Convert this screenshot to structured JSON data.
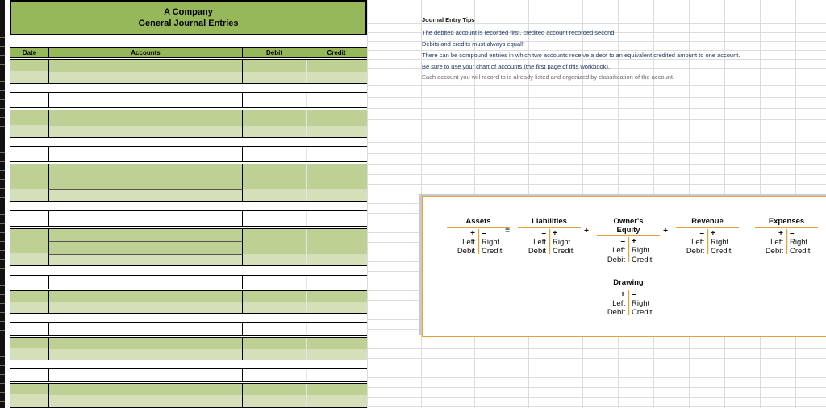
{
  "workbook": {
    "sheet_title_line1": "A Company",
    "sheet_title_line2": "General Journal Entries"
  },
  "journal": {
    "columns": {
      "date": "Date",
      "accounts": "Accounts",
      "debit": "Debit",
      "credit": "Credit"
    },
    "rows": []
  },
  "tips": {
    "heading": "Journal Entry Tips",
    "lines": [
      "The debited account is recorded first, credited account recorded second.",
      "Debits and credits must always equal!",
      "There can be compound entries in which two accounts receive a debt to an equivalent credited amount to one account.",
      "Be sure to use your chart of accounts (the first page of this workbook).",
      "Each account you will record to is already listed and organized by classification of the account."
    ]
  },
  "accounting_equation": {
    "accounts": [
      {
        "name": "Assets",
        "name_line1": "Assets",
        "name_line2": "",
        "left_sign": "+",
        "right_sign": "–",
        "left_side": "Left",
        "left_entry": "Debit",
        "right_side": "Right",
        "right_entry": "Credit"
      },
      {
        "name": "Liabilities",
        "name_line1": "Liabilities",
        "name_line2": "",
        "left_sign": "–",
        "right_sign": "+",
        "left_side": "Left",
        "left_entry": "Debit",
        "right_side": "Right",
        "right_entry": "Credit"
      },
      {
        "name": "Owner's Equity",
        "name_line1": "Owner's",
        "name_line2": "Equity",
        "left_sign": "–",
        "right_sign": "+",
        "left_side": "Left",
        "left_entry": "Debit",
        "right_side": "Right",
        "right_entry": "Credit"
      },
      {
        "name": "Revenue",
        "name_line1": "Revenue",
        "name_line2": "",
        "left_sign": "–",
        "right_sign": "+",
        "left_side": "Left",
        "left_entry": "Debit",
        "right_side": "Right",
        "right_entry": "Credit"
      },
      {
        "name": "Expenses",
        "name_line1": "Expenses",
        "name_line2": "",
        "left_sign": "+",
        "right_sign": "–",
        "left_side": "Left",
        "left_entry": "Debit",
        "right_side": "Right",
        "right_entry": "Credit"
      }
    ],
    "drawing": {
      "name": "Drawing",
      "name_line1": "Drawing",
      "name_line2": "",
      "left_sign": "+",
      "right_sign": "–",
      "left_side": "Left",
      "left_entry": "Debit",
      "right_side": "Right",
      "right_entry": "Credit"
    },
    "operators": [
      "=",
      "+",
      "+",
      "–"
    ]
  },
  "colors": {
    "header_green": "#96b75a",
    "band_green_dark": "#bed094",
    "band_green_light": "#d5e0bb",
    "diagram_border": "#e2a33c",
    "grid_line": "#dcdcdc",
    "tip_text": "#1f3864"
  }
}
